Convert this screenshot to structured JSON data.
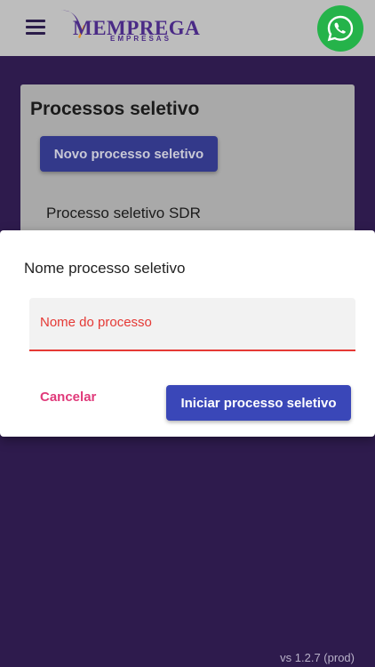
{
  "header": {
    "logo_text": "MEMPREGA",
    "logo_subtext": "EMPRESAS"
  },
  "card": {
    "title": "Processos seletivo",
    "new_button_label": "Novo processo seletivo",
    "items": [
      {
        "label": "Processo seletivo SDR"
      }
    ]
  },
  "dialog": {
    "title": "Nome processo seletivo",
    "input": {
      "placeholder": "Nome do processo",
      "value": ""
    },
    "cancel_label": "Cancelar",
    "confirm_label": "Iniciar processo seletivo"
  },
  "footer": {
    "version": "vs 1.2.7 (prod)"
  },
  "colors": {
    "background": "#2e1b4d",
    "header": "#bdbdbd",
    "primary_button": "#3a47b8",
    "accent_pink": "#e03a7a",
    "error_red": "#e53935",
    "whatsapp_green": "#25b34a"
  },
  "icons": {
    "menu": "hamburger-menu-icon",
    "whatsapp": "whatsapp-icon"
  }
}
